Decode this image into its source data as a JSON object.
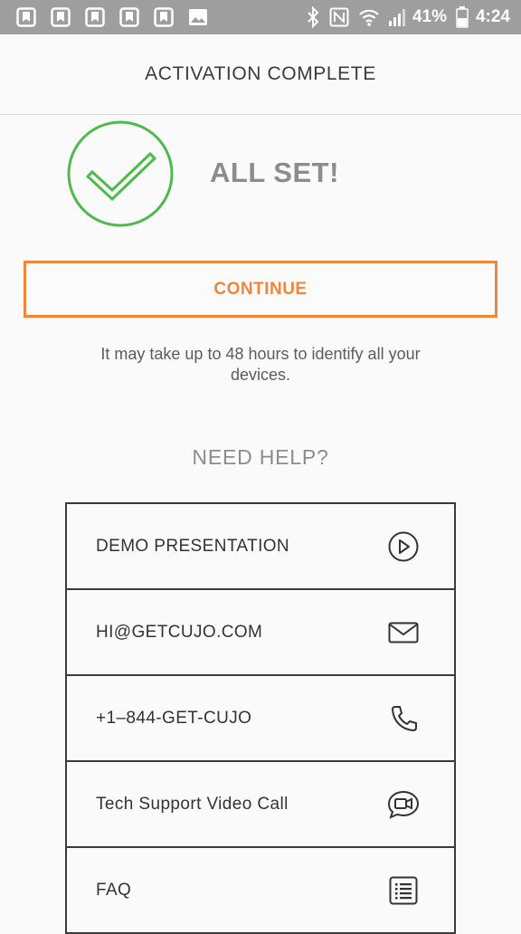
{
  "status_bar": {
    "battery_text": "41%",
    "time": "4:24",
    "notification_icons": [
      "bookmark-app-icon",
      "bookmark-app-icon",
      "bookmark-app-icon",
      "bookmark-app-icon",
      "bookmark-app-icon",
      "image-icon"
    ],
    "system_icons": [
      "bluetooth-icon",
      "nfc-icon",
      "wifi-icon",
      "signal-icon",
      "battery-icon"
    ]
  },
  "header": {
    "title": "ACTIVATION COMPLETE"
  },
  "success": {
    "text": "ALL SET!",
    "icon": "check-circle-icon",
    "icon_color": "#4cbb4c"
  },
  "continue": {
    "label": "CONTINUE",
    "accent_color": "#f0853c"
  },
  "info": {
    "text": "It may take up to 48 hours to identify all your devices."
  },
  "help": {
    "title": "NEED HELP?",
    "items": [
      {
        "label": "DEMO PRESENTATION",
        "icon": "play-icon"
      },
      {
        "label": "HI@GETCUJO.COM",
        "icon": "email-icon"
      },
      {
        "label": "+1–844-GET-CUJO",
        "icon": "phone-icon"
      },
      {
        "label": "Tech Support Video Call",
        "icon": "video-call-icon"
      },
      {
        "label": "FAQ",
        "icon": "list-icon"
      }
    ]
  }
}
